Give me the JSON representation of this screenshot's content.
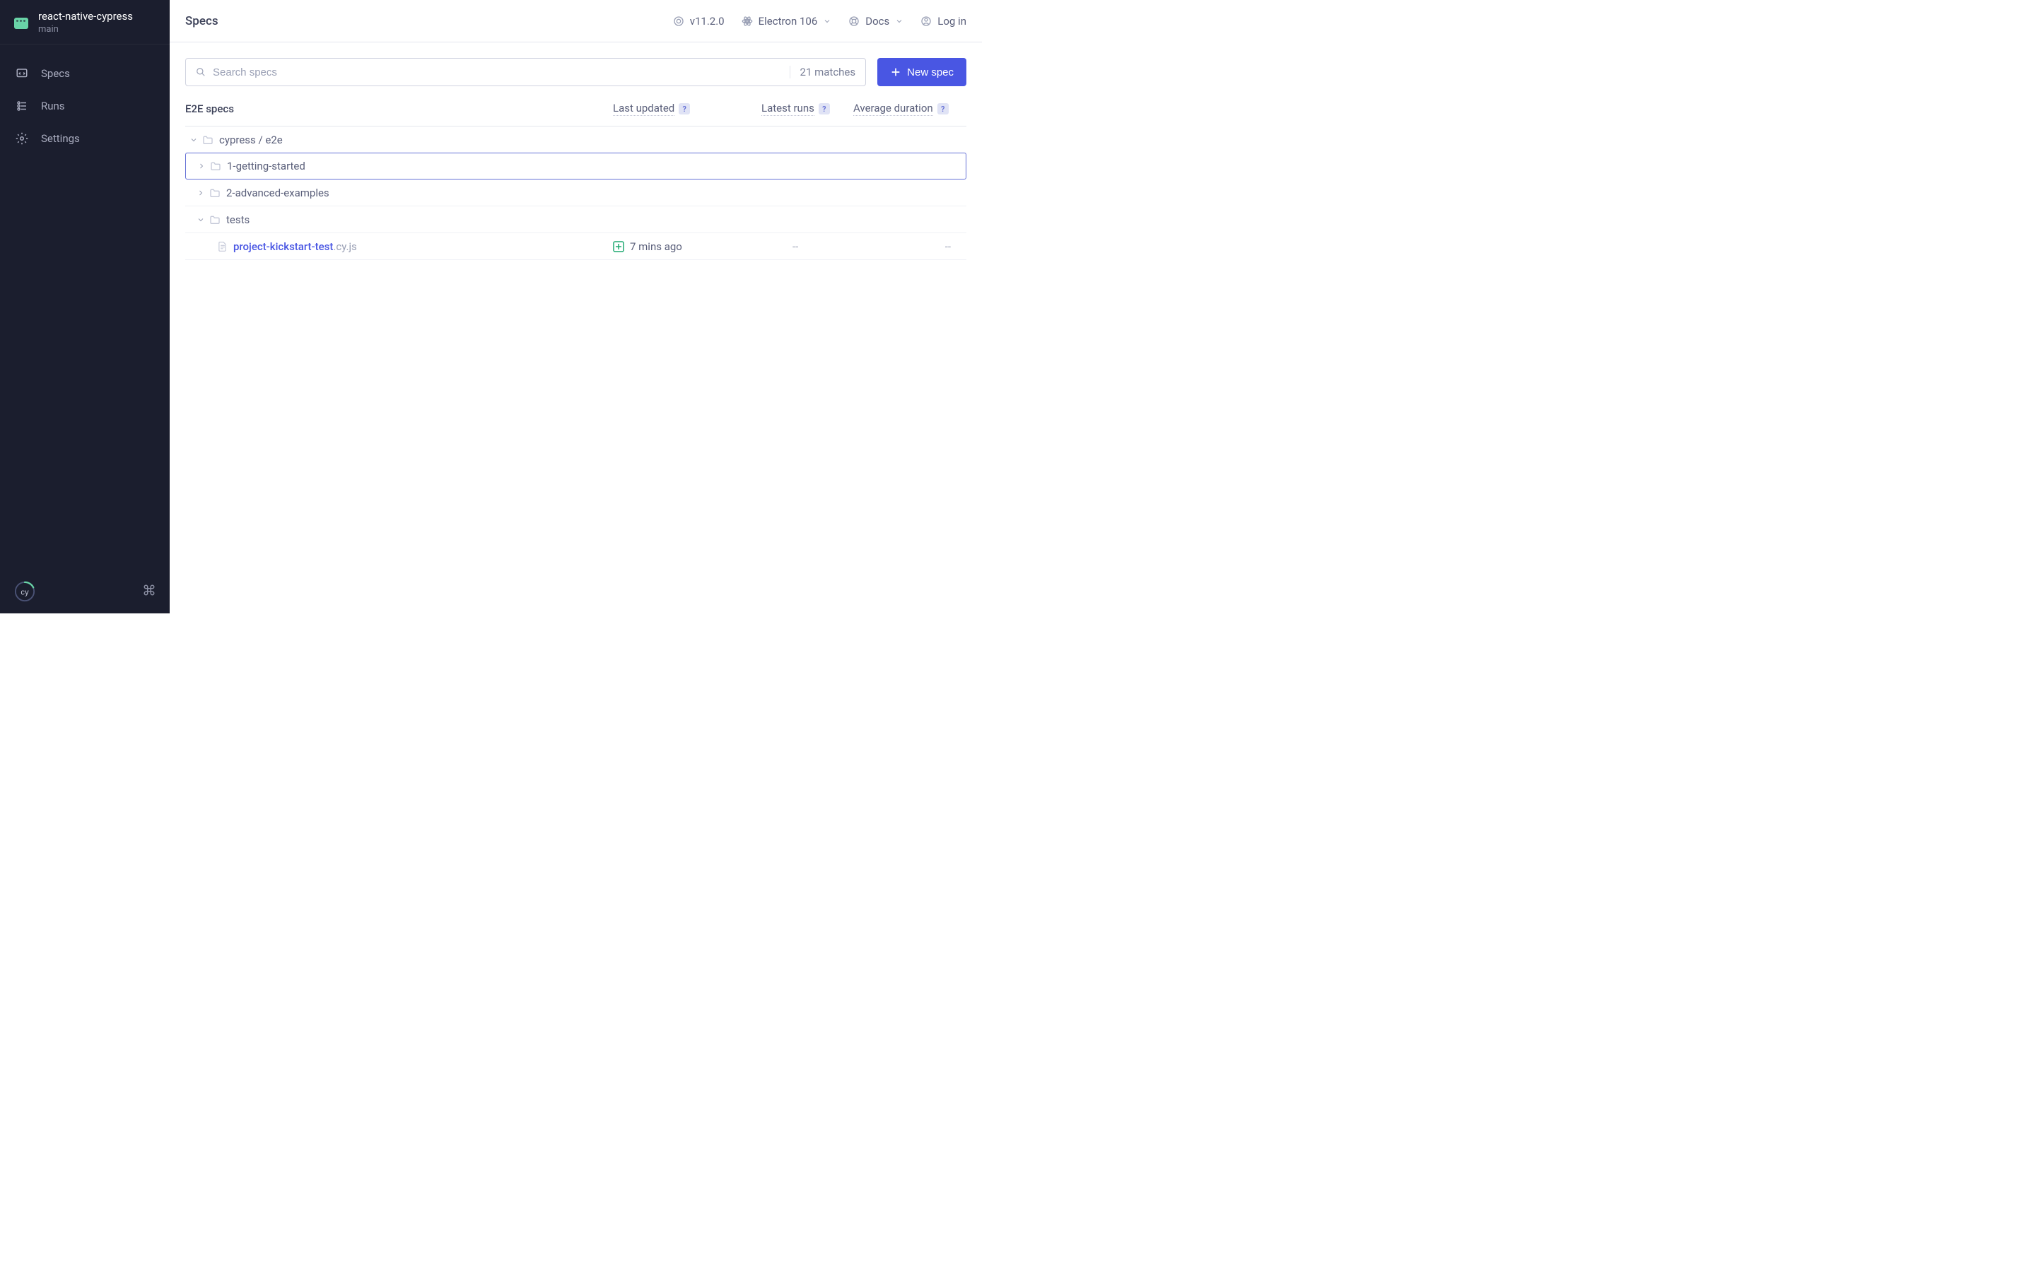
{
  "sidebar": {
    "project_name": "react-native-cypress",
    "branch": "main",
    "nav": [
      {
        "label": "Specs"
      },
      {
        "label": "Runs"
      },
      {
        "label": "Settings"
      }
    ]
  },
  "topbar": {
    "title": "Specs",
    "version": "v11.2.0",
    "browser": "Electron 106",
    "docs": "Docs",
    "login": "Log in"
  },
  "search": {
    "placeholder": "Search specs",
    "matches_label": "21 matches"
  },
  "new_spec_label": "New spec",
  "columns": {
    "name": "E2E specs",
    "updated": "Last updated",
    "runs": "Latest runs",
    "duration": "Average duration"
  },
  "tree": {
    "root_folder": "cypress / e2e",
    "folders": [
      {
        "name": "1-getting-started",
        "expanded": false,
        "selected": true
      },
      {
        "name": "2-advanced-examples",
        "expanded": false,
        "selected": false
      },
      {
        "name": "tests",
        "expanded": true,
        "selected": false
      }
    ],
    "file": {
      "name": "project-kickstart-test",
      "ext": ".cy.js",
      "updated": "7 mins ago",
      "runs": "--",
      "duration": "--"
    }
  }
}
